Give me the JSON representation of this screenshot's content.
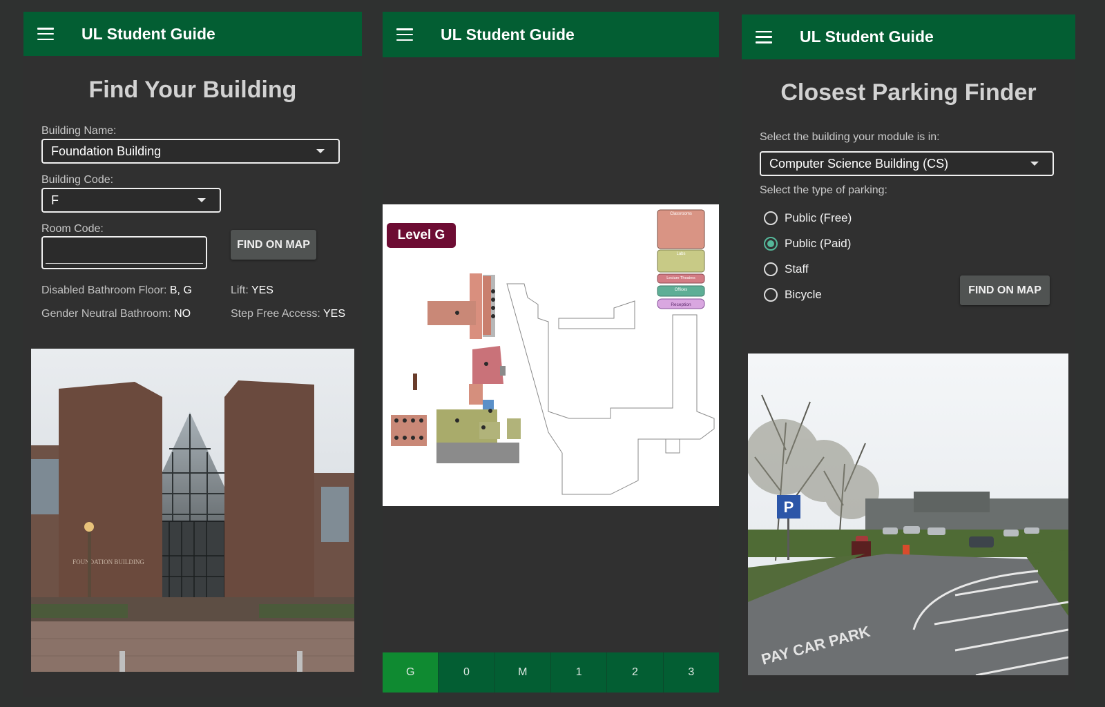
{
  "screens": [
    {
      "app_title": "UL Student Guide",
      "heading": "Find Your Building",
      "building_name_label": "Building Name:",
      "building_name_value": "Foundation Building",
      "building_code_label": "Building Code:",
      "building_code_value": "F",
      "room_code_label": "Room Code:",
      "room_code_value": "",
      "find_button": "FIND ON MAP",
      "disabled_bathroom_label": "Disabled Bathroom Floor:",
      "disabled_bathroom_value": "B, G",
      "lift_label": "Lift:",
      "lift_value": "YES",
      "gender_neutral_label": "Gender Neutral Bathroom:",
      "gender_neutral_value": "NO",
      "step_free_label": "Step Free Access:",
      "step_free_value": "YES",
      "photo_sign": "FOUNDATION BUILDING"
    },
    {
      "app_title": "UL Student Guide",
      "level_badge": "Level G",
      "legend": [
        "Classrooms",
        "Labs",
        "Lecture Theatres",
        "Offices",
        "Reception"
      ],
      "floor_tabs": [
        "G",
        "0",
        "M",
        "1",
        "2",
        "3"
      ],
      "active_tab": "G"
    },
    {
      "app_title": "UL Student Guide",
      "heading": "Closest Parking Finder",
      "building_label": "Select the building your module is in:",
      "building_value": "Computer Science Building (CS)",
      "parking_label": "Select the type of parking:",
      "parking_options": [
        "Public (Free)",
        "Public (Paid)",
        "Staff",
        "Bicycle"
      ],
      "selected_parking": "Public (Paid)",
      "find_button": "FIND ON MAP",
      "photo_road_text": "PAY CAR PARK",
      "photo_sign": "P"
    }
  ],
  "colors": {
    "app_bar": "#035e33",
    "active_tab": "#0f8a31",
    "level_badge": "#6d0c33",
    "radio_accent": "#55b89a"
  }
}
